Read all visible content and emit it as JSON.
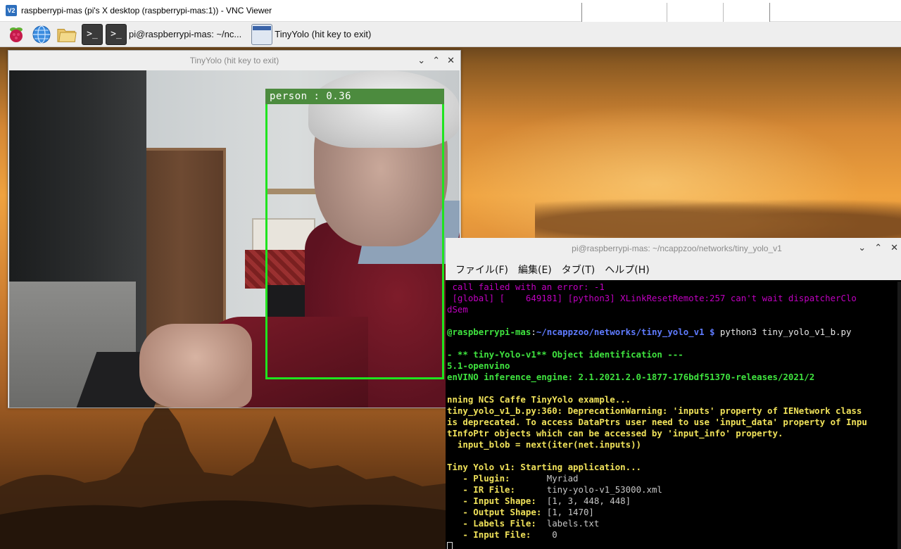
{
  "vnc": {
    "title": "raspberrypi-mas (pi's X desktop (raspberrypi-mas:1)) - VNC Viewer",
    "icon_label": "V2"
  },
  "taskbar": {
    "icons": [
      "raspberry-pi-menu-icon",
      "web-browser-icon",
      "file-manager-icon",
      "terminal-icon"
    ],
    "tasks": [
      {
        "label": "pi@raspberrypi-mas: ~/nc...",
        "icon": "terminal-icon"
      },
      {
        "label": "TinyYolo (hit key to exit)",
        "icon": "window-icon"
      }
    ]
  },
  "yolo_window": {
    "title": "TinyYolo (hit key to exit)",
    "controls": [
      "⌄",
      "⌃",
      "✕"
    ],
    "detection": {
      "label": "person : 0.36",
      "box_color": "#1fe41f"
    }
  },
  "terminal": {
    "title": "pi@raspberrypi-mas: ~/ncappzoo/networks/tiny_yolo_v1",
    "controls": [
      "⌄",
      "⌃",
      "✕"
    ],
    "menu": [
      "ファイル(F)",
      "編集(E)",
      "タブ(T)",
      "ヘルプ(H)"
    ],
    "lines": [
      [
        {
          "c": "mag",
          "t": " call failed with an error: -1"
        }
      ],
      [
        {
          "c": "mag",
          "t": " [global] [    649181] [python3] XLinkResetRemote:257 can't wait dispatcherClo"
        }
      ],
      [
        {
          "c": "mag",
          "t": "dSem"
        }
      ],
      [
        {
          "c": "wht",
          "t": ""
        }
      ],
      [
        {
          "c": "grn",
          "t": "@raspberrypi-mas"
        },
        {
          "c": "wht",
          "t": ":"
        },
        {
          "c": "blu",
          "t": "~/ncappzoo/networks/tiny_yolo_v1 $"
        },
        {
          "c": "wht",
          "t": " python3 tiny_yolo_v1_b.py"
        }
      ],
      [
        {
          "c": "wht",
          "t": ""
        }
      ],
      [
        {
          "c": "grn",
          "t": "- ** tiny-Yolo-v1** Object identification ---"
        }
      ],
      [
        {
          "c": "grn",
          "t": "5.1-openvino"
        }
      ],
      [
        {
          "c": "grn",
          "t": "enVINO inference_engine: 2.1.2021.2.0-1877-176bdf51370-releases/2021/2"
        }
      ],
      [
        {
          "c": "wht",
          "t": ""
        }
      ],
      [
        {
          "c": "ylw",
          "t": "nning NCS Caffe TinyYolo example..."
        }
      ],
      [
        {
          "c": "ylw",
          "t": "tiny_yolo_v1_b.py:360: DeprecationWarning: 'inputs' property of IENetwork class"
        }
      ],
      [
        {
          "c": "ylw",
          "t": "is deprecated. To access DataPtrs user need to use 'input_data' property of Inpu"
        }
      ],
      [
        {
          "c": "ylw",
          "t": "tInfoPtr objects which can be accessed by 'input_info' property."
        }
      ],
      [
        {
          "c": "ylw",
          "t": "  input_blob = next(iter(net.inputs))"
        }
      ],
      [
        {
          "c": "wht",
          "t": ""
        }
      ],
      [
        {
          "c": "ylw",
          "t": "Tiny Yolo v1: Starting application..."
        }
      ],
      [
        {
          "c": "ylw",
          "t": "   - Plugin:       "
        },
        {
          "c": "gry",
          "t": "Myriad"
        }
      ],
      [
        {
          "c": "ylw",
          "t": "   - IR File:      "
        },
        {
          "c": "gry",
          "t": "tiny-yolo-v1_53000.xml"
        }
      ],
      [
        {
          "c": "ylw",
          "t": "   - Input Shape:  "
        },
        {
          "c": "gry",
          "t": "[1, 3, 448, 448]"
        }
      ],
      [
        {
          "c": "ylw",
          "t": "   - Output Shape: "
        },
        {
          "c": "gry",
          "t": "[1, 1470]"
        }
      ],
      [
        {
          "c": "ylw",
          "t": "   - Labels File:  "
        },
        {
          "c": "gry",
          "t": "labels.txt"
        }
      ],
      [
        {
          "c": "ylw",
          "t": "   - Input File:    "
        },
        {
          "c": "gry",
          "t": "0"
        }
      ]
    ]
  }
}
